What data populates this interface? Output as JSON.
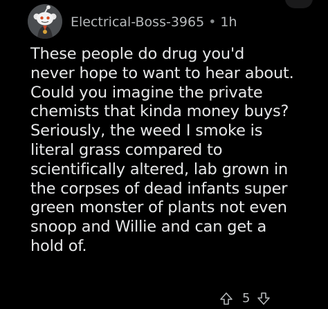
{
  "comment": {
    "author": "Electrical-Boss-3965",
    "separator": "•",
    "age": "1h",
    "lines": [
      "These people do drug you'd",
      "never hope to want to hear about.",
      "Could you imagine the private",
      "chemists that kinda money buys?",
      "Seriously, the weed I smoke is",
      "literal grass compared to",
      "scientifically altered, lab grown in",
      "the corpses of dead infants super",
      "green monster of plants not even",
      "snoop and Willie and can get a",
      "hold of."
    ],
    "score": "5"
  },
  "icons": {
    "avatar": "snoo-avatar",
    "upvote": "upvote-icon",
    "downvote": "downvote-icon"
  },
  "colors": {
    "background": "#000000",
    "text": "#e6e7e8",
    "meta": "#b6b9bb"
  }
}
